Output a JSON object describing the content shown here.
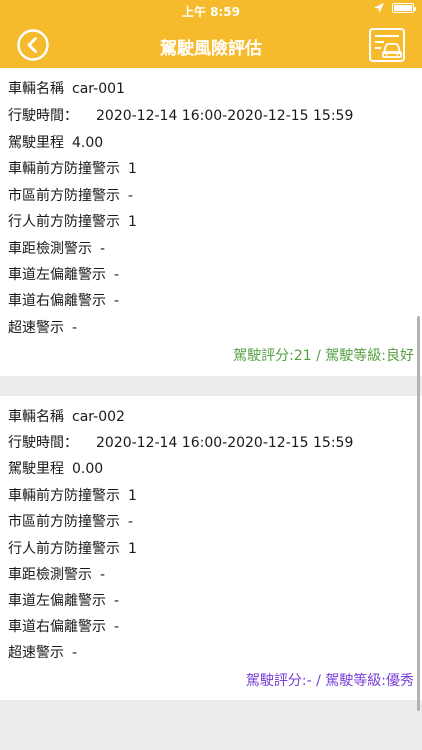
{
  "status_bar": {
    "time": "上午 8:59"
  },
  "nav": {
    "title": "駕駛風險評估"
  },
  "colors": {
    "header": "#f5bb2c",
    "score_good": "#55a044",
    "score_excellent": "#7a3fd6"
  },
  "cards": [
    {
      "vehicle_label": "車輛名稱",
      "vehicle_name": "car-001",
      "time_label": "行駛時間：",
      "time_value": "2020-12-14 16:00-2020-12-15 15:59",
      "mileage_label": "駕駛里程",
      "mileage_value": "4.00",
      "fcw_label": "車輛前方防撞警示",
      "fcw_value": "1",
      "ufcw_label": "市區前方防撞警示",
      "ufcw_value": "-",
      "pcw_label": "行人前方防撞警示",
      "pcw_value": "1",
      "hmw_label": "車距檢測警示",
      "hmw_value": "-",
      "ldw_left_label": "車道左偏離警示",
      "ldw_left_value": "-",
      "ldw_right_label": "車道右偏離警示",
      "ldw_right_value": "-",
      "speed_label": "超速警示",
      "speed_value": "-",
      "summary": "駕駛評分:21 / 駕駛等級:良好"
    },
    {
      "vehicle_label": "車輛名稱",
      "vehicle_name": "car-002",
      "time_label": "行駛時間：",
      "time_value": "2020-12-14 16:00-2020-12-15 15:59",
      "mileage_label": "駕駛里程",
      "mileage_value": "0.00",
      "fcw_label": "車輛前方防撞警示",
      "fcw_value": "1",
      "ufcw_label": "市區前方防撞警示",
      "ufcw_value": "-",
      "pcw_label": "行人前方防撞警示",
      "pcw_value": "1",
      "hmw_label": "車距檢測警示",
      "hmw_value": "-",
      "ldw_left_label": "車道左偏離警示",
      "ldw_left_value": "-",
      "ldw_right_label": "車道右偏離警示",
      "ldw_right_value": "-",
      "speed_label": "超速警示",
      "speed_value": "-",
      "summary": "駕駛評分:- / 駕駛等級:優秀"
    }
  ]
}
